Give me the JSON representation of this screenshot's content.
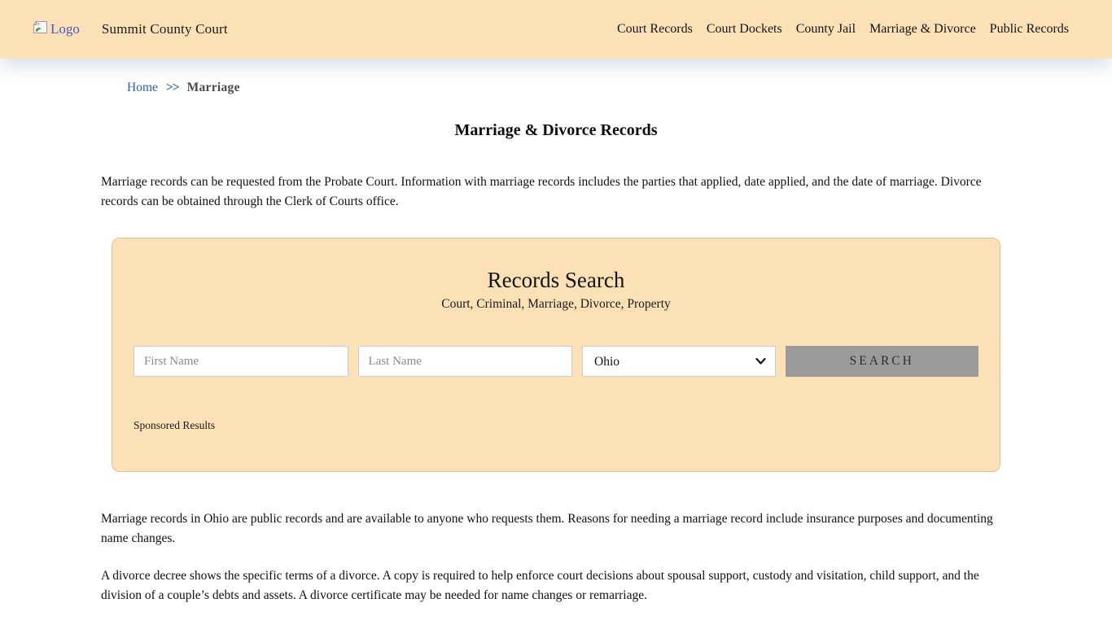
{
  "header": {
    "logo_alt": "Logo",
    "brand": "Summit County Court",
    "nav": [
      {
        "label": "Court Records"
      },
      {
        "label": "Court Dockets"
      },
      {
        "label": "County Jail"
      },
      {
        "label": "Marriage & Divorce"
      },
      {
        "label": "Public Records"
      }
    ]
  },
  "breadcrumb": {
    "home": "Home",
    "separator": ">>",
    "current": "Marriage"
  },
  "page": {
    "title": "Marriage & Divorce Records",
    "intro": "Marriage records can be requested from the Probate Court. Information with marriage records includes the parties that applied, date applied, and the date of marriage. Divorce records can be obtained through the Clerk of Courts office.",
    "paragraph_marriage": "Marriage records in Ohio are public records and are available to anyone who requests them. Reasons for needing a marriage record include insurance purposes and documenting name changes.",
    "paragraph_divorce": "A divorce decree shows the specific terms of a divorce. A copy is required to help enforce court decisions about spousal support, custody and visitation, child support, and the division of a couple’s debts and assets. A divorce certificate may be needed for name changes or remarriage."
  },
  "search_panel": {
    "title": "Records Search",
    "subtitle": "Court, Criminal, Marriage, Divorce, Property",
    "first_name_placeholder": "First Name",
    "last_name_placeholder": "Last Name",
    "state_selected": "Ohio",
    "search_button": "SEARCH",
    "sponsored_label": "Sponsored Results"
  },
  "colors": {
    "header_bg": "#FBE1B5",
    "panel_bg": "#FBE1B5",
    "panel_border": "#E3C18C",
    "link_blue": "#2A62A9",
    "logo_alt_blue": "#4A55C8",
    "button_gray": "#9B9B9B"
  }
}
